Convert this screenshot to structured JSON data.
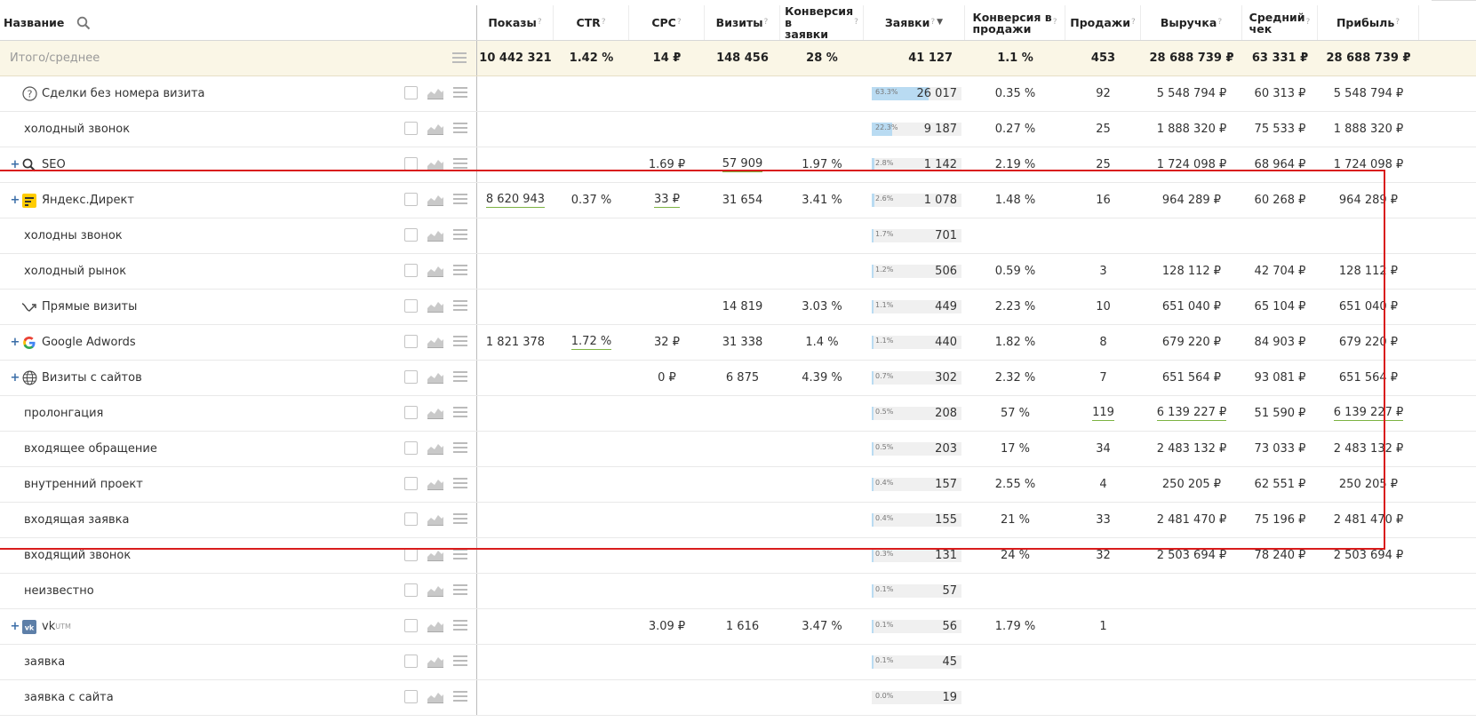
{
  "header": {
    "name_label": "Название",
    "columns": [
      {
        "label": "Показы",
        "help": "?"
      },
      {
        "label": "CTR",
        "help": "?"
      },
      {
        "label": "CPC",
        "help": "?"
      },
      {
        "label": "Визиты",
        "help": "?"
      },
      {
        "label": "Конверсия в",
        "label2": "заявки",
        "help": "?"
      },
      {
        "label": "Заявки",
        "help": "?",
        "sort": "▼"
      },
      {
        "label": "Конверсия в",
        "label2": "продажи",
        "help": "?"
      },
      {
        "label": "Продажи",
        "help": "?"
      },
      {
        "label": "Выручка",
        "help": "?"
      },
      {
        "label": "Средний",
        "label2": "чек",
        "help": "?"
      },
      {
        "label": "Прибыль",
        "help": "?"
      }
    ]
  },
  "total": {
    "name": "Итого/среднее",
    "values": [
      "10 442 321",
      "1.42 %",
      "14 ₽",
      "148 456",
      "28 %",
      "41 127",
      "1.1 %",
      "453",
      "28 688 739 ₽",
      "63 331 ₽",
      "28 688 739 ₽"
    ]
  },
  "rows": [
    {
      "name": "Сделки без номера визита",
      "plus": false,
      "icon": "question-icon",
      "values": [
        "",
        "",
        "",
        "",
        "",
        "26 017",
        "0.35 %",
        "92",
        "5 548 794 ₽",
        "60 313 ₽",
        "5 548 794 ₽"
      ],
      "pct": "63.3%",
      "share": 0.633
    },
    {
      "name": "холодный звонок",
      "plus": false,
      "icon": "",
      "values": [
        "",
        "",
        "",
        "",
        "",
        "9 187",
        "0.27 %",
        "25",
        "1 888 320 ₽",
        "75 533 ₽",
        "1 888 320 ₽"
      ],
      "pct": "22.3%",
      "share": 0.223
    },
    {
      "name": "SEO",
      "plus": true,
      "icon": "search-icon",
      "values": [
        "",
        "",
        "1.69 ₽",
        "57 909",
        "1.97 %",
        "1 142",
        "2.19 %",
        "25",
        "1 724 098 ₽",
        "68 964 ₽",
        "1 724 098 ₽"
      ],
      "pct": "2.8%",
      "share": 0.028
    },
    {
      "name": "Яндекс.Директ",
      "plus": true,
      "icon": "yandex-direct-icon",
      "values": [
        "8 620 943",
        "0.37 %",
        "33 ₽",
        "31 654",
        "3.41 %",
        "1 078",
        "1.48 %",
        "16",
        "964 289 ₽",
        "60 268 ₽",
        "964 289 ₽"
      ],
      "pct": "2.6%",
      "share": 0.026
    },
    {
      "name": "холодны звонок",
      "plus": false,
      "icon": "",
      "values": [
        "",
        "",
        "",
        "",
        "",
        "701",
        "",
        "",
        "",
        "",
        ""
      ],
      "pct": "1.7%",
      "share": 0.017
    },
    {
      "name": "холодный рынок",
      "plus": false,
      "icon": "",
      "values": [
        "",
        "",
        "",
        "",
        "",
        "506",
        "0.59 %",
        "3",
        "128 112 ₽",
        "42 704 ₽",
        "128 112 ₽"
      ],
      "pct": "1.2%",
      "share": 0.012
    },
    {
      "name": "Прямые визиты",
      "plus": false,
      "icon": "direct-visits-icon",
      "values": [
        "",
        "",
        "",
        "14 819",
        "3.03 %",
        "449",
        "2.23 %",
        "10",
        "651 040 ₽",
        "65 104 ₽",
        "651 040 ₽"
      ],
      "pct": "1.1%",
      "share": 0.011
    },
    {
      "name": "Google Adwords",
      "plus": true,
      "icon": "google-icon",
      "values": [
        "1 821 378",
        "1.72 %",
        "32 ₽",
        "31 338",
        "1.4 %",
        "440",
        "1.82 %",
        "8",
        "679 220 ₽",
        "84 903 ₽",
        "679 220 ₽"
      ],
      "pct": "1.1%",
      "share": 0.011
    },
    {
      "name": "Визиты с сайтов",
      "plus": true,
      "icon": "globe-icon",
      "values": [
        "",
        "",
        "0 ₽",
        "6 875",
        "4.39 %",
        "302",
        "2.32 %",
        "7",
        "651 564 ₽",
        "93 081 ₽",
        "651 564 ₽"
      ],
      "pct": "0.7%",
      "share": 0.007
    },
    {
      "name": "пролонгация",
      "plus": false,
      "icon": "",
      "values": [
        "",
        "",
        "",
        "",
        "",
        "208",
        "57 %",
        "119",
        "6 139 227 ₽",
        "51 590 ₽",
        "6 139 227 ₽"
      ],
      "pct": "0.5%",
      "share": 0.005
    },
    {
      "name": "входящее обращение",
      "plus": false,
      "icon": "",
      "values": [
        "",
        "",
        "",
        "",
        "",
        "203",
        "17 %",
        "34",
        "2 483 132 ₽",
        "73 033 ₽",
        "2 483 132 ₽"
      ],
      "pct": "0.5%",
      "share": 0.005
    },
    {
      "name": "внутренний проект",
      "plus": false,
      "icon": "",
      "values": [
        "",
        "",
        "",
        "",
        "",
        "157",
        "2.55 %",
        "4",
        "250 205 ₽",
        "62 551 ₽",
        "250 205 ₽"
      ],
      "pct": "0.4%",
      "share": 0.004
    },
    {
      "name": "входящая заявка",
      "plus": false,
      "icon": "",
      "values": [
        "",
        "",
        "",
        "",
        "",
        "155",
        "21 %",
        "33",
        "2 481 470 ₽",
        "75 196 ₽",
        "2 481 470 ₽"
      ],
      "pct": "0.4%",
      "share": 0.004
    },
    {
      "name": "входящий звонок",
      "plus": false,
      "icon": "",
      "values": [
        "",
        "",
        "",
        "",
        "",
        "131",
        "24 %",
        "32",
        "2 503 694 ₽",
        "78 240 ₽",
        "2 503 694 ₽"
      ],
      "pct": "0.3%",
      "share": 0.003
    },
    {
      "name": "неизвестно",
      "plus": false,
      "icon": "",
      "values": [
        "",
        "",
        "",
        "",
        "",
        "57",
        "",
        "",
        "",
        "",
        ""
      ],
      "pct": "0.1%",
      "share": 0.001
    },
    {
      "name": "vk",
      "sup": "UTM",
      "plus": true,
      "icon": "vk-icon",
      "values": [
        "",
        "",
        "3.09 ₽",
        "1 616",
        "3.47 %",
        "56",
        "1.79 %",
        "1",
        "",
        "",
        ""
      ],
      "pct": "0.1%",
      "share": 0.001
    },
    {
      "name": "заявка",
      "plus": false,
      "icon": "",
      "values": [
        "",
        "",
        "",
        "",
        "",
        "45",
        "",
        "",
        "",
        "",
        ""
      ],
      "pct": "0.1%",
      "share": 0.001
    },
    {
      "name": "заявка с сайта",
      "plus": false,
      "icon": "",
      "values": [
        "",
        "",
        "",
        "",
        "",
        "19",
        "",
        "",
        "",
        "",
        ""
      ],
      "pct": "0.0%",
      "share": 0.0
    }
  ],
  "colors": {
    "accent_bar": "#b9dbf2",
    "highlight_box": "#d91c1c",
    "total_bg": "#faf6e6",
    "underline": "#7cb342"
  }
}
